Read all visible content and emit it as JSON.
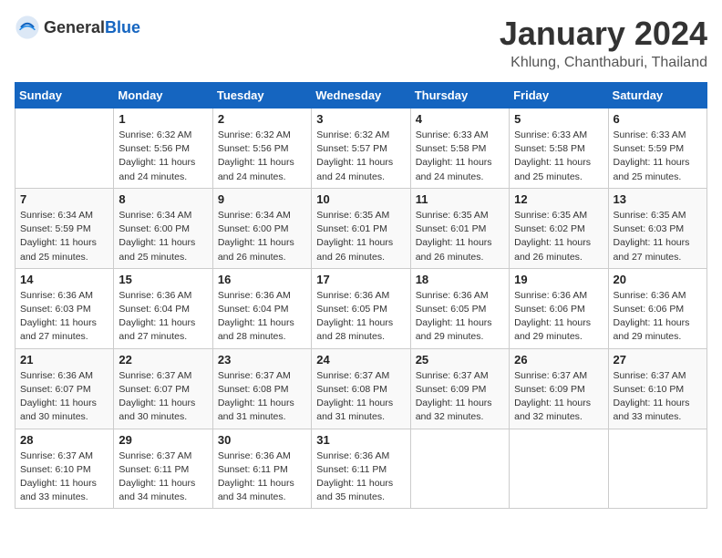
{
  "logo": {
    "general": "General",
    "blue": "Blue"
  },
  "title": "January 2024",
  "subtitle": "Khlung, Chanthaburi, Thailand",
  "headers": [
    "Sunday",
    "Monday",
    "Tuesday",
    "Wednesday",
    "Thursday",
    "Friday",
    "Saturday"
  ],
  "weeks": [
    [
      {
        "day": "",
        "info": ""
      },
      {
        "day": "1",
        "info": "Sunrise: 6:32 AM\nSunset: 5:56 PM\nDaylight: 11 hours\nand 24 minutes."
      },
      {
        "day": "2",
        "info": "Sunrise: 6:32 AM\nSunset: 5:56 PM\nDaylight: 11 hours\nand 24 minutes."
      },
      {
        "day": "3",
        "info": "Sunrise: 6:32 AM\nSunset: 5:57 PM\nDaylight: 11 hours\nand 24 minutes."
      },
      {
        "day": "4",
        "info": "Sunrise: 6:33 AM\nSunset: 5:58 PM\nDaylight: 11 hours\nand 24 minutes."
      },
      {
        "day": "5",
        "info": "Sunrise: 6:33 AM\nSunset: 5:58 PM\nDaylight: 11 hours\nand 25 minutes."
      },
      {
        "day": "6",
        "info": "Sunrise: 6:33 AM\nSunset: 5:59 PM\nDaylight: 11 hours\nand 25 minutes."
      }
    ],
    [
      {
        "day": "7",
        "info": "Sunrise: 6:34 AM\nSunset: 5:59 PM\nDaylight: 11 hours\nand 25 minutes."
      },
      {
        "day": "8",
        "info": "Sunrise: 6:34 AM\nSunset: 6:00 PM\nDaylight: 11 hours\nand 25 minutes."
      },
      {
        "day": "9",
        "info": "Sunrise: 6:34 AM\nSunset: 6:00 PM\nDaylight: 11 hours\nand 26 minutes."
      },
      {
        "day": "10",
        "info": "Sunrise: 6:35 AM\nSunset: 6:01 PM\nDaylight: 11 hours\nand 26 minutes."
      },
      {
        "day": "11",
        "info": "Sunrise: 6:35 AM\nSunset: 6:01 PM\nDaylight: 11 hours\nand 26 minutes."
      },
      {
        "day": "12",
        "info": "Sunrise: 6:35 AM\nSunset: 6:02 PM\nDaylight: 11 hours\nand 26 minutes."
      },
      {
        "day": "13",
        "info": "Sunrise: 6:35 AM\nSunset: 6:03 PM\nDaylight: 11 hours\nand 27 minutes."
      }
    ],
    [
      {
        "day": "14",
        "info": "Sunrise: 6:36 AM\nSunset: 6:03 PM\nDaylight: 11 hours\nand 27 minutes."
      },
      {
        "day": "15",
        "info": "Sunrise: 6:36 AM\nSunset: 6:04 PM\nDaylight: 11 hours\nand 27 minutes."
      },
      {
        "day": "16",
        "info": "Sunrise: 6:36 AM\nSunset: 6:04 PM\nDaylight: 11 hours\nand 28 minutes."
      },
      {
        "day": "17",
        "info": "Sunrise: 6:36 AM\nSunset: 6:05 PM\nDaylight: 11 hours\nand 28 minutes."
      },
      {
        "day": "18",
        "info": "Sunrise: 6:36 AM\nSunset: 6:05 PM\nDaylight: 11 hours\nand 29 minutes."
      },
      {
        "day": "19",
        "info": "Sunrise: 6:36 AM\nSunset: 6:06 PM\nDaylight: 11 hours\nand 29 minutes."
      },
      {
        "day": "20",
        "info": "Sunrise: 6:36 AM\nSunset: 6:06 PM\nDaylight: 11 hours\nand 29 minutes."
      }
    ],
    [
      {
        "day": "21",
        "info": "Sunrise: 6:36 AM\nSunset: 6:07 PM\nDaylight: 11 hours\nand 30 minutes."
      },
      {
        "day": "22",
        "info": "Sunrise: 6:37 AM\nSunset: 6:07 PM\nDaylight: 11 hours\nand 30 minutes."
      },
      {
        "day": "23",
        "info": "Sunrise: 6:37 AM\nSunset: 6:08 PM\nDaylight: 11 hours\nand 31 minutes."
      },
      {
        "day": "24",
        "info": "Sunrise: 6:37 AM\nSunset: 6:08 PM\nDaylight: 11 hours\nand 31 minutes."
      },
      {
        "day": "25",
        "info": "Sunrise: 6:37 AM\nSunset: 6:09 PM\nDaylight: 11 hours\nand 32 minutes."
      },
      {
        "day": "26",
        "info": "Sunrise: 6:37 AM\nSunset: 6:09 PM\nDaylight: 11 hours\nand 32 minutes."
      },
      {
        "day": "27",
        "info": "Sunrise: 6:37 AM\nSunset: 6:10 PM\nDaylight: 11 hours\nand 33 minutes."
      }
    ],
    [
      {
        "day": "28",
        "info": "Sunrise: 6:37 AM\nSunset: 6:10 PM\nDaylight: 11 hours\nand 33 minutes."
      },
      {
        "day": "29",
        "info": "Sunrise: 6:37 AM\nSunset: 6:11 PM\nDaylight: 11 hours\nand 34 minutes."
      },
      {
        "day": "30",
        "info": "Sunrise: 6:36 AM\nSunset: 6:11 PM\nDaylight: 11 hours\nand 34 minutes."
      },
      {
        "day": "31",
        "info": "Sunrise: 6:36 AM\nSunset: 6:11 PM\nDaylight: 11 hours\nand 35 minutes."
      },
      {
        "day": "",
        "info": ""
      },
      {
        "day": "",
        "info": ""
      },
      {
        "day": "",
        "info": ""
      }
    ]
  ]
}
